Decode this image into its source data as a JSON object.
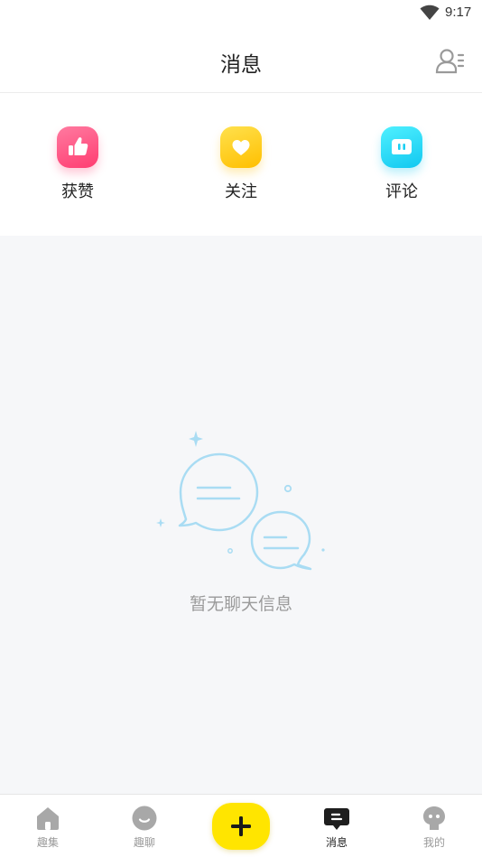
{
  "status_bar": {
    "time": "9:17",
    "wifi_icon": "wifi-icon"
  },
  "header": {
    "title": "消息",
    "contacts_icon": "contacts-list-icon"
  },
  "quick_actions": [
    {
      "label": "获赞",
      "icon": "thumbs-up-icon",
      "color": "#ff4d7e"
    },
    {
      "label": "关注",
      "icon": "heart-icon",
      "color": "#ffc600"
    },
    {
      "label": "评论",
      "icon": "chat-bubble-icon",
      "color": "#1ccff2"
    }
  ],
  "empty_state": {
    "text": "暂无聊天信息",
    "icon": "empty-chat-illustration",
    "color": "#a9dcf3"
  },
  "tabbar": {
    "items": [
      {
        "label": "趣集",
        "icon": "home-icon",
        "active": false
      },
      {
        "label": "趣聊",
        "icon": "smile-chat-icon",
        "active": false
      },
      {
        "label": "",
        "icon": "plus-icon",
        "active": false
      },
      {
        "label": "消息",
        "icon": "message-icon",
        "active": true
      },
      {
        "label": "我的",
        "icon": "profile-icon",
        "active": false
      }
    ],
    "publish_color": "#ffe500"
  }
}
